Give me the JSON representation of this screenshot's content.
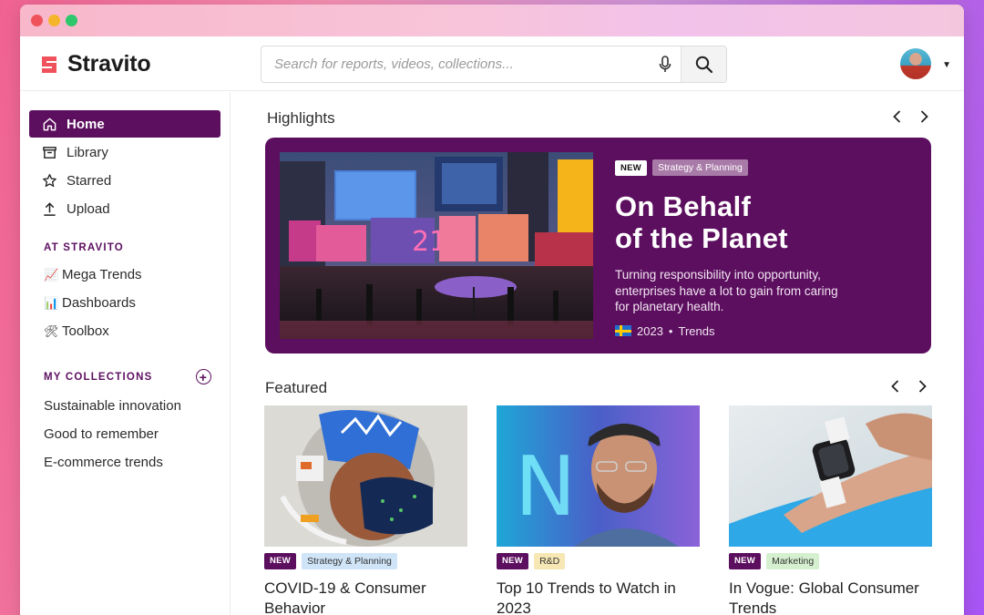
{
  "app": {
    "name": "Stravito",
    "brand_color": "#5c0f5f",
    "logo_color": "#f0525b"
  },
  "search": {
    "placeholder": "Search for reports, videos, collections..."
  },
  "sidebar": {
    "main_items": [
      {
        "label": "Home",
        "icon": "home-icon",
        "active": true
      },
      {
        "label": "Library",
        "icon": "library-icon",
        "active": false
      },
      {
        "label": "Starred",
        "icon": "star-icon",
        "active": false
      },
      {
        "label": "Upload",
        "icon": "upload-icon",
        "active": false
      }
    ],
    "at_stravito": {
      "heading": "AT STRAVITO",
      "items": [
        {
          "label": "Mega Trends",
          "icon": "chart-increasing-icon"
        },
        {
          "label": "Dashboards",
          "icon": "bar-chart-icon"
        },
        {
          "label": "Toolbox",
          "icon": "tools-icon"
        }
      ]
    },
    "my_collections": {
      "heading": "MY COLLECTIONS",
      "items": [
        {
          "label": "Sustainable innovation"
        },
        {
          "label": "Good to remember"
        },
        {
          "label": "E-commerce trends"
        }
      ]
    }
  },
  "highlights": {
    "title": "Highlights",
    "hero": {
      "badge": "NEW",
      "category": "Strategy & Planning",
      "category_color": "#a87aa8",
      "title_line1": "On Behalf",
      "title_line2": "of the Planet",
      "description": "Turning responsibility into opportunity, enterprises have a lot to gain from caring for planetary health.",
      "year": "2023",
      "separator": "•",
      "type": "Trends"
    }
  },
  "featured": {
    "title": "Featured",
    "cards": [
      {
        "badge": "NEW",
        "category": "Strategy & Planning",
        "category_color": "#cfe4f7",
        "title": "COVID-19 & Consumer Behavior"
      },
      {
        "badge": "NEW",
        "category": "R&D",
        "category_color": "#f6e7b4",
        "title": "Top 10 Trends to Watch in 2023"
      },
      {
        "badge": "NEW",
        "category": "Marketing",
        "category_color": "#d5f0cf",
        "title": "In Vogue: Global Consumer Trends"
      }
    ]
  }
}
